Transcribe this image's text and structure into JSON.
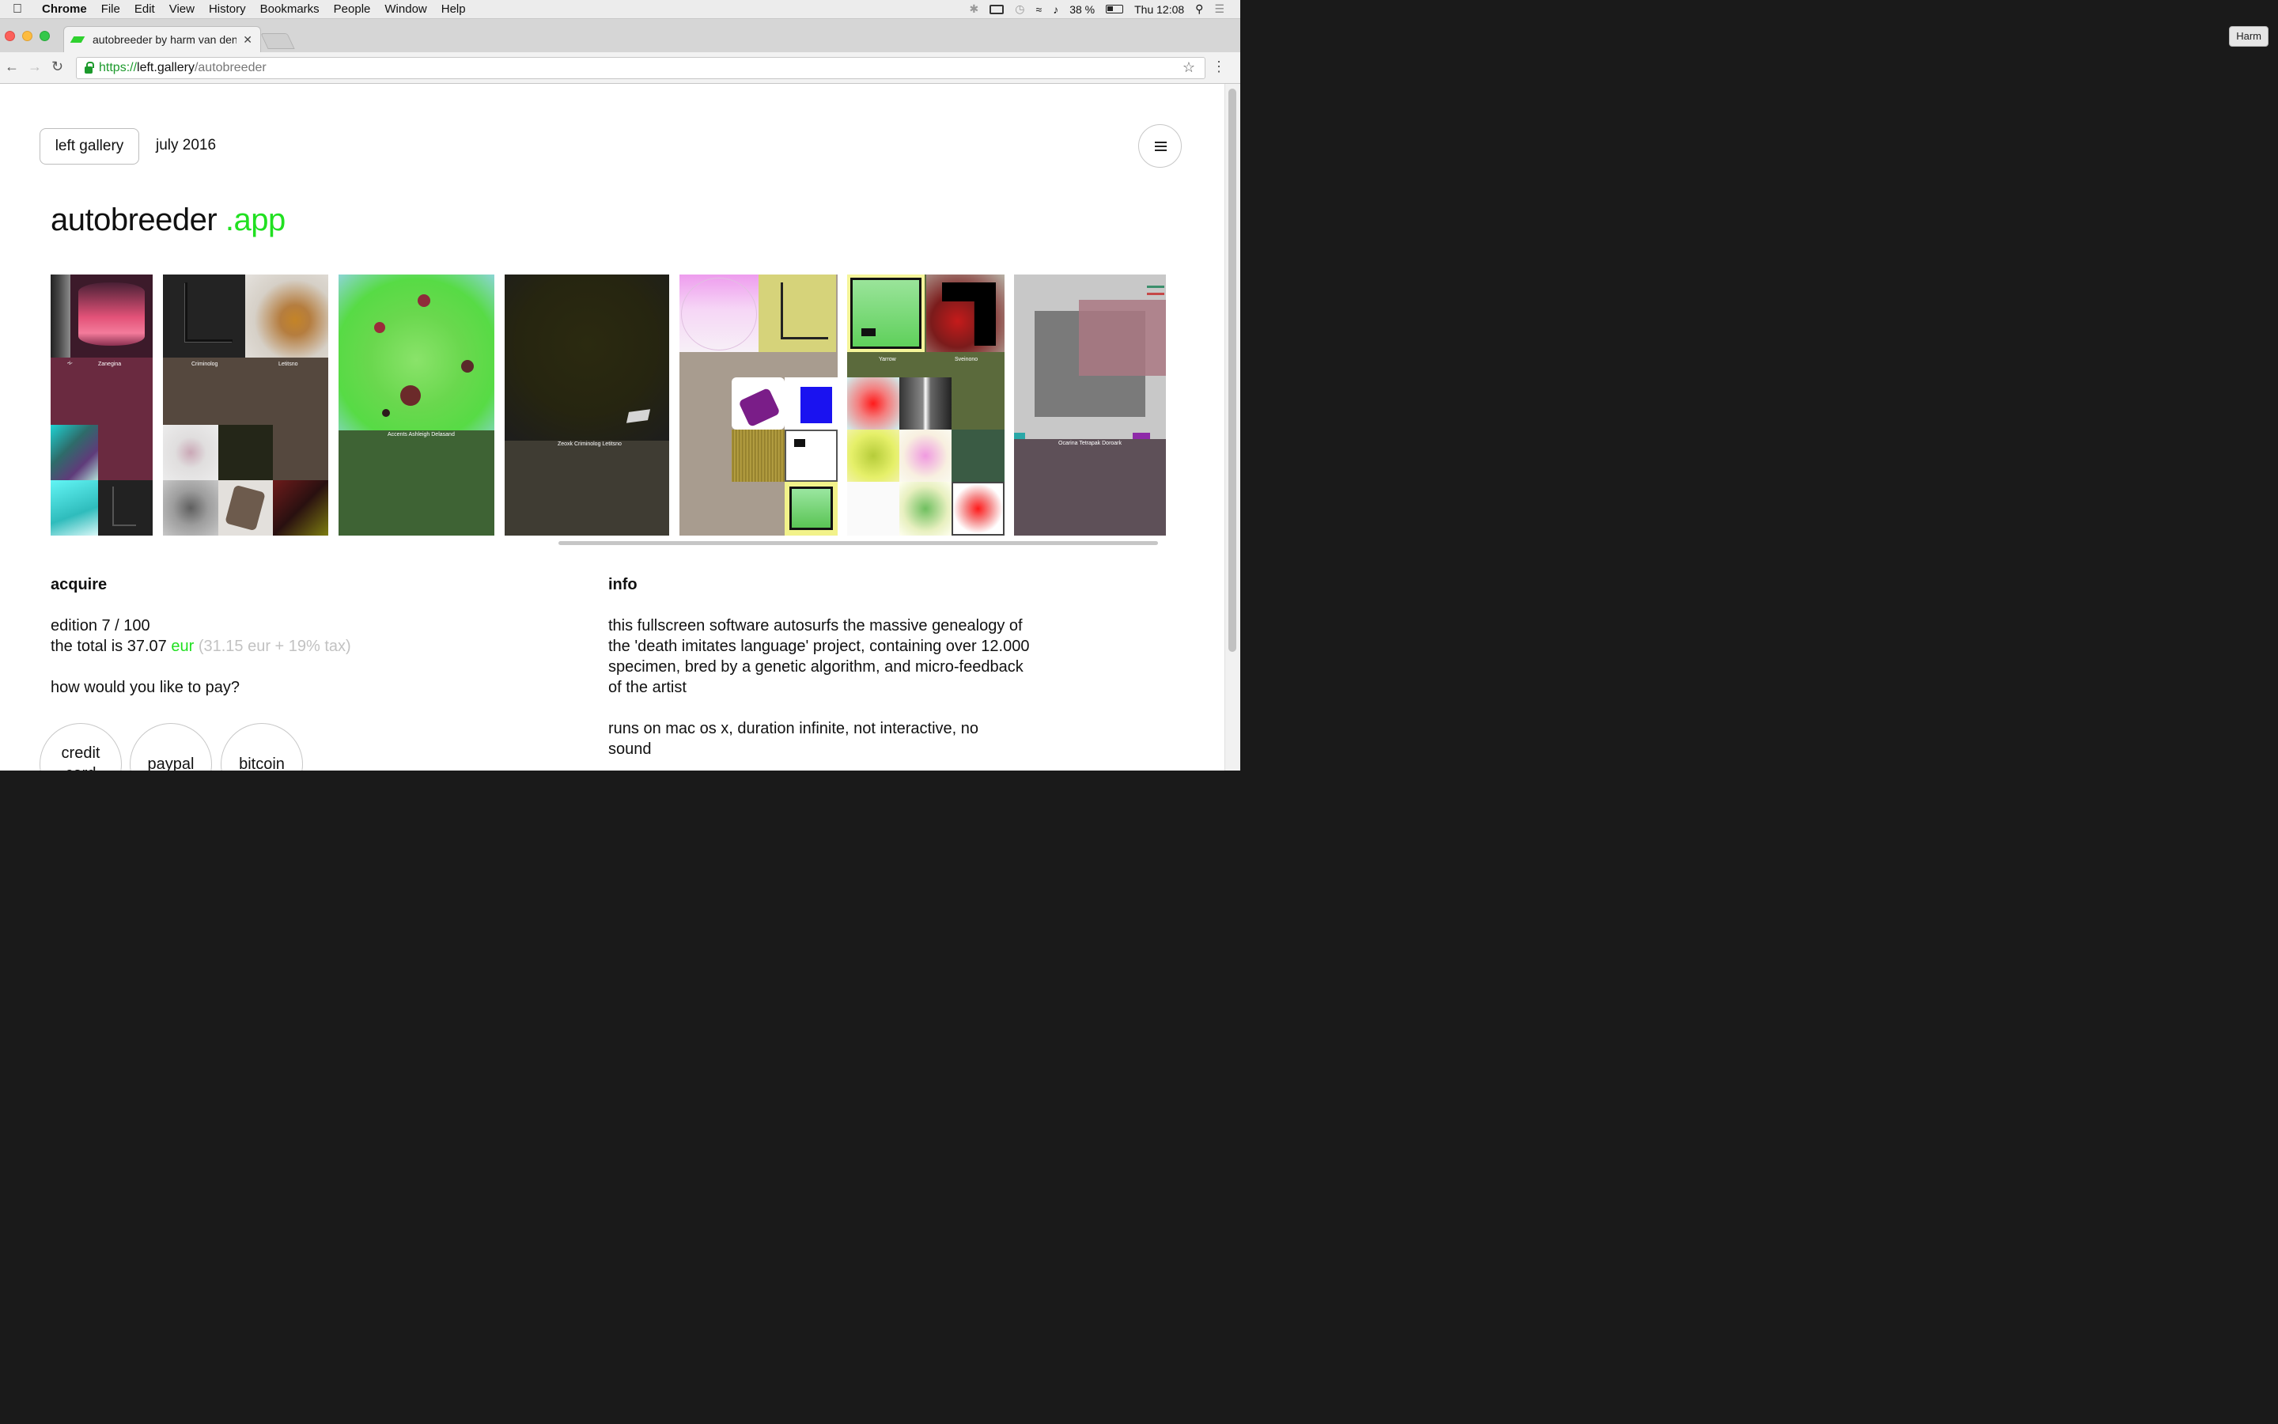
{
  "menubar": {
    "app": "Chrome",
    "items": [
      "File",
      "Edit",
      "View",
      "History",
      "Bookmarks",
      "People",
      "Window",
      "Help"
    ],
    "battery": "38 %",
    "clock": "Thu 12:08"
  },
  "browser": {
    "tab_title": "autobreeder by harm van den d",
    "profile": "Harm",
    "url_scheme": "https://",
    "url_host": "left.gallery",
    "url_path": "/autobreeder"
  },
  "site": {
    "brand": "left gallery",
    "date": "july 2016",
    "title": "autobreeder",
    "title_ext": ".app"
  },
  "gallery": {
    "labels": {
      "c1": "Zanegina",
      "c2a": "Criminolog",
      "c2b": "Letitsno",
      "c3": "Accents Ashleigh Delasand",
      "c4": "Zeoxk Criminolog Letitsno",
      "c6a": "Yarrow",
      "c6b": "Sveinono",
      "c7": "Ocarina Tetrapak Doroark"
    }
  },
  "acquire": {
    "heading": "acquire",
    "edition": "edition 7 / 100",
    "total_prefix": "the total is 37.07",
    "currency": "eur",
    "breakdown": "(31.15 eur + 19% tax)",
    "question": "how would you like to pay?",
    "pay_options": [
      "credit card",
      "paypal",
      "bitcoin"
    ]
  },
  "info": {
    "heading": "info",
    "description": "this fullscreen software autosurfs the massive genealogy of the 'death imitates language' project, containing over 12.000 specimen, bred by a genetic algorithm, and micro-feedback of the artist",
    "specs": "runs on mac os x, duration infinite, not interactive, no sound"
  }
}
